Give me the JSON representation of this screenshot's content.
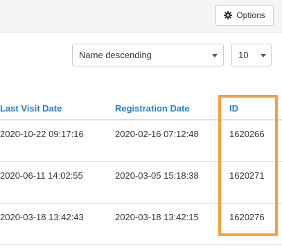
{
  "toolbar": {
    "options_label": "Options",
    "options_icon": "gear-icon"
  },
  "controls": {
    "sort_value": "Name descending",
    "page_size_value": "10"
  },
  "table": {
    "columns": [
      "Last Visit Date",
      "Registration Date",
      "ID"
    ],
    "rows": [
      [
        "2020-10-22 09:17:16",
        "2020-02-16 07:12:48",
        "1620266"
      ],
      [
        "2020-06-11 14:02:55",
        "2020-03-05 15:18:38",
        "1620271"
      ],
      [
        "2020-03-18 13:42:43",
        "2020-03-18 13:42:15",
        "1620276"
      ]
    ]
  },
  "colors": {
    "link": "#2a7fc4",
    "highlight": "#f5a040"
  }
}
